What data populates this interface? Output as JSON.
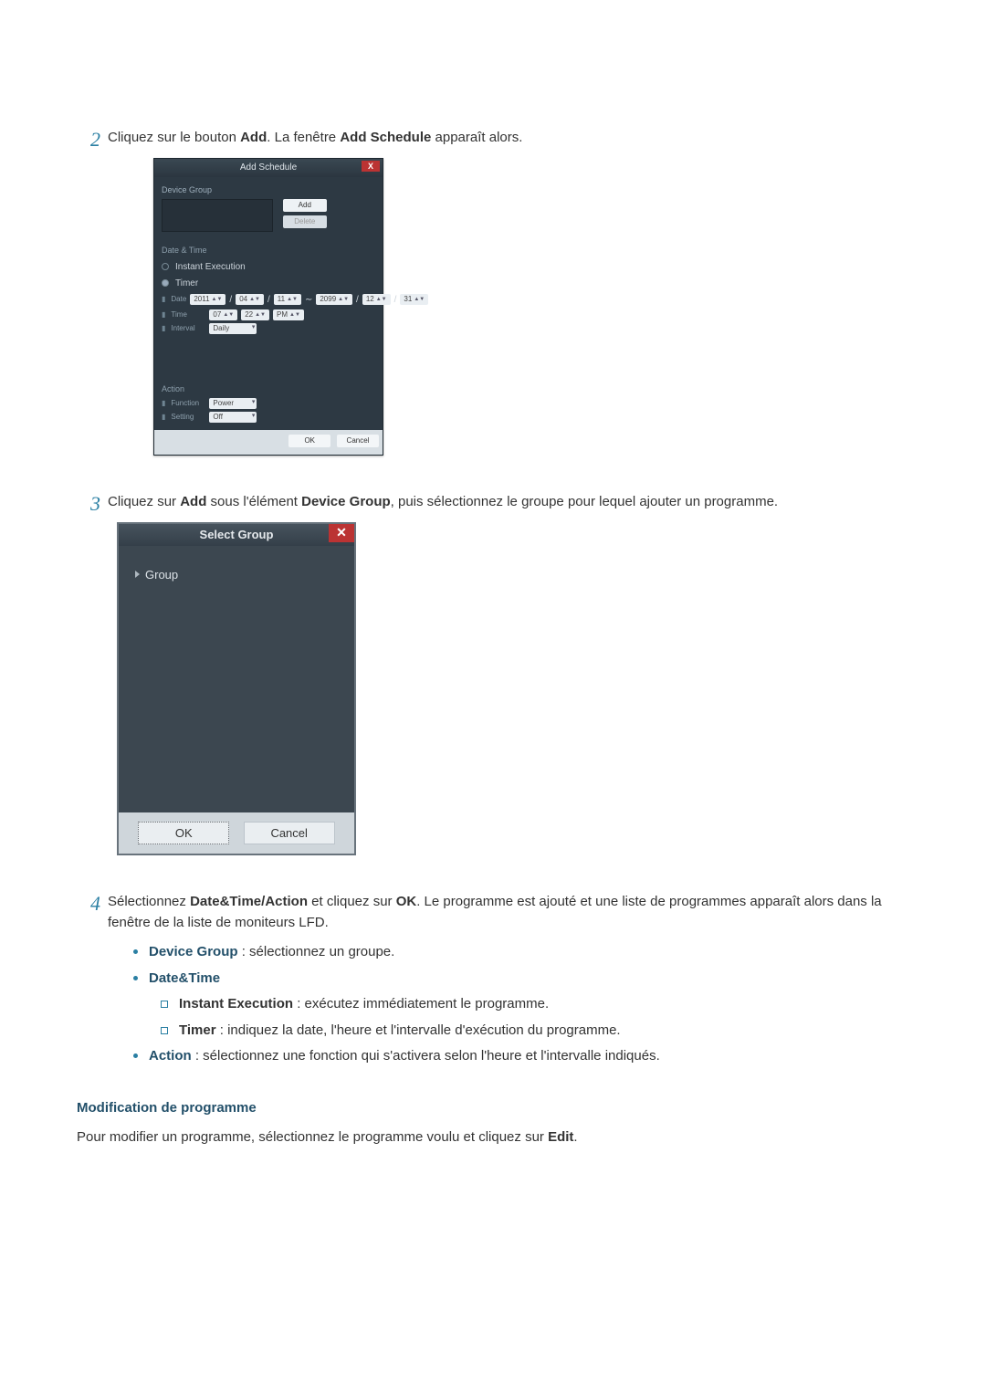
{
  "step2": {
    "num": "2",
    "pre": "Cliquez sur le bouton ",
    "b1": "Add",
    "mid": ". La fenêtre ",
    "b2": "Add Schedule",
    "post": " apparaît alors."
  },
  "add_schedule": {
    "title": "Add Schedule",
    "device_group_label": "Device Group",
    "btn_add": "Add",
    "btn_delete": "Delete",
    "date_time_label": "Date & Time",
    "radio_instant": "Instant Execution",
    "radio_timer": "Timer",
    "row_date_label": "Date",
    "date_y1": "2011",
    "date_m1": "04",
    "date_d1": "11",
    "date_sep": "/",
    "date_range_sep": "∼",
    "date_y2": "2099",
    "date_m2": "12",
    "date_d2": "31",
    "row_time_label": "Time",
    "time_h": "07",
    "time_m": "22",
    "time_ampm": "PM",
    "row_interval_label": "Interval",
    "interval_val": "Daily",
    "action_label": "Action",
    "row_function_label": "Function",
    "function_val": "Power",
    "row_setting_label": "Setting",
    "setting_val": "Off",
    "btn_ok": "OK",
    "btn_cancel": "Cancel"
  },
  "step3": {
    "num": "3",
    "pre": "Cliquez sur ",
    "b1": "Add",
    "mid1": " sous l'élément ",
    "b2": "Device Group",
    "post": ", puis sélectionnez le groupe pour lequel ajouter un programme."
  },
  "select_group": {
    "title": "Select Group",
    "tree_root": "Group",
    "btn_ok": "OK",
    "btn_cancel": "Cancel"
  },
  "step4": {
    "num": "4",
    "pre": "Sélectionnez ",
    "b1": "Date&Time/Action",
    "mid1": " et cliquez sur ",
    "b2": "OK",
    "post": ". Le programme est ajouté et une liste de programmes apparaît alors dans la fenêtre de la liste de moniteurs LFD.",
    "bul_devgrp_label": "Device Group",
    "bul_devgrp_text": " : sélectionnez un groupe.",
    "bul_dt_label": "Date&Time",
    "bul_instant_label": "Instant Execution",
    "bul_instant_text": " : exécutez immédiatement le programme.",
    "bul_timer_label": "Timer",
    "bul_timer_text": " : indiquez la date, l'heure et l'intervalle d'exécution du programme.",
    "bul_action_label": "Action",
    "bul_action_text": " : sélectionnez une fonction qui s'activera selon l'heure et l'intervalle indiqués."
  },
  "section": {
    "heading": "Modification de programme",
    "para_pre": "Pour modifier un programme, sélectionnez le programme voulu et cliquez sur ",
    "para_b": "Edit",
    "para_post": "."
  }
}
